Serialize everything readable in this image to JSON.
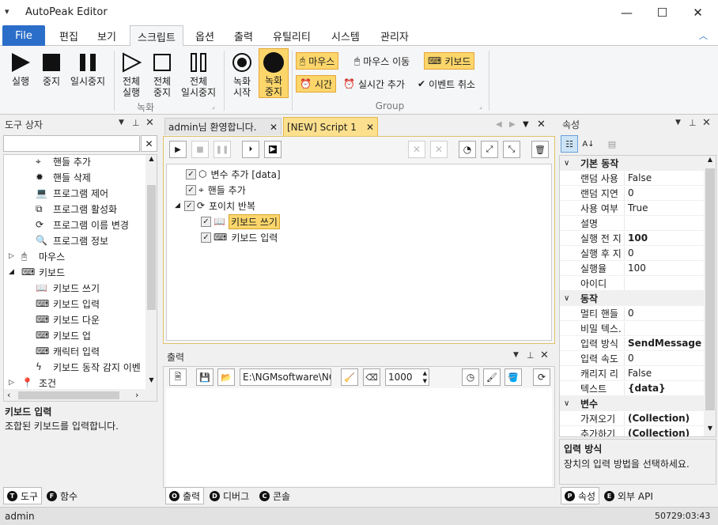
{
  "app": {
    "title": "AutoPeak Editor"
  },
  "menu": {
    "items": [
      "File",
      "편집",
      "보기",
      "스크립트",
      "옵션",
      "출력",
      "유틸리티",
      "시스템",
      "관리자"
    ]
  },
  "ribbon": {
    "run": "실행",
    "stop": "중지",
    "pause": "일시중지",
    "all_run": [
      "전체",
      "실행"
    ],
    "all_stop": [
      "전체",
      "중지"
    ],
    "all_pause": [
      "전체",
      "일시중지"
    ],
    "rec_start": [
      "녹화",
      "시작"
    ],
    "rec_stop": [
      "녹화",
      "중지"
    ],
    "group_record": "녹화",
    "mouse": "마우스",
    "mouse_move": "마우스 이동",
    "keyboard": "키보드",
    "time": "시간",
    "realtime_add": "실시간 추가",
    "event_cancel": "이벤트 취소",
    "group_group": "Group"
  },
  "toolbox": {
    "title": "도구 상자",
    "search_placeholder": "",
    "items": [
      "핸들 추가",
      "핸들 삭제",
      "프로그램 제어",
      "프로그램 활성화",
      "프로그램 이름 변경",
      "프로그램 정보",
      "마우스",
      "키보드",
      "키보드 쓰기",
      "키보드 입력",
      "키보드 다운",
      "키보드 업",
      "캐릭터 입력",
      "키보드 동작 감지 이벤",
      "조건"
    ],
    "desc_title": "키보드 입력",
    "desc_text": "조합된 키보드를 입력합니다.",
    "tab_tools": "도구",
    "tab_funcs": "함수"
  },
  "editor": {
    "tab1": "admin님 환영합니다.",
    "tab2": "[NEW] Script 1",
    "nodes": [
      "변수 추가 [data]",
      "핸들 추가",
      "포이치 반복",
      "키보드 쓰기",
      "키보드 입력"
    ]
  },
  "output": {
    "title": "출력",
    "path": "E:\\NGMsoftware\\NG",
    "count": "1000",
    "tab_output": "출력",
    "tab_debug": "디버그",
    "tab_console": "콘솔"
  },
  "props": {
    "title": "속성",
    "cat1": "기본 동작",
    "rows1": [
      [
        "랜덤 사용",
        "False",
        false
      ],
      [
        "랜덤 지연",
        "0",
        false
      ],
      [
        "사용 여부",
        "True",
        false
      ],
      [
        "설명",
        "",
        false
      ],
      [
        "실행 전 지",
        "100",
        true
      ],
      [
        "실행 후 지",
        "0",
        false
      ],
      [
        "실행율",
        "100",
        false
      ],
      [
        "아이디",
        "",
        false
      ]
    ],
    "cat2": "동작",
    "rows2": [
      [
        "멀티 핸들",
        "0",
        false
      ],
      [
        "비밀 텍스.",
        "",
        false
      ],
      [
        "입력 방식",
        "SendMessage",
        true
      ],
      [
        "입력 속도",
        "0",
        false
      ],
      [
        "캐리지 리",
        "False",
        false
      ],
      [
        "텍스트",
        "{data}",
        true
      ]
    ],
    "cat3": "변수",
    "rows3": [
      [
        "가져오기",
        "(Collection)",
        true
      ],
      [
        "추가하기",
        "(Collection)",
        true
      ]
    ],
    "desc_title": "입력 방식",
    "desc_text": "장치의 입력 방법을 선택하세요.",
    "tab_props": "속성",
    "tab_api": "외부 API"
  },
  "status": {
    "user": "admin",
    "time": "50729:03:43"
  }
}
